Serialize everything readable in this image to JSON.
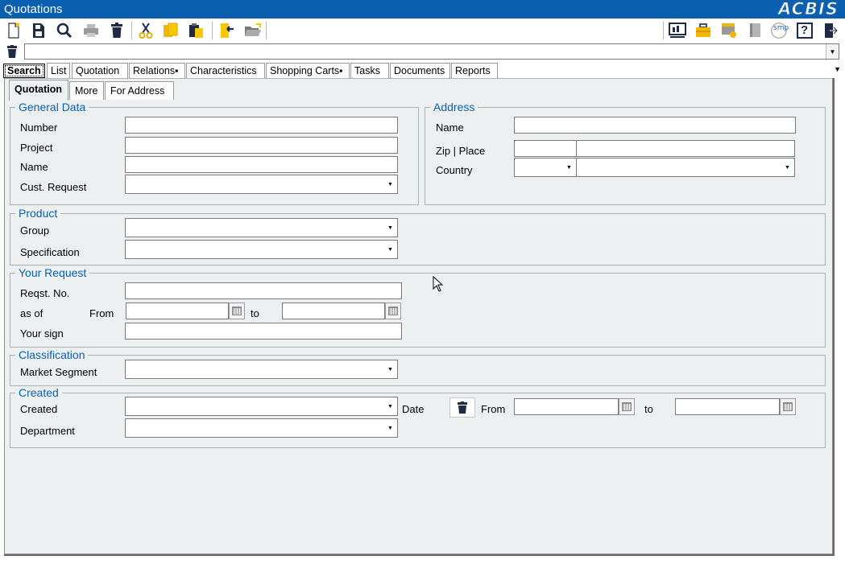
{
  "window": {
    "title": "Quotations",
    "logo": "ACBIS"
  },
  "toolbar": {
    "left_icons": [
      "new-document-icon",
      "save-icon",
      "search-icon",
      "print-icon",
      "delete-icon",
      "cut-icon",
      "copy-icon",
      "paste-icon",
      "import-icon",
      "open-folder-icon"
    ],
    "right_icons": [
      "monitor-icon",
      "briefcase-icon",
      "window-icon",
      "book-icon",
      "smp-icon",
      "help-icon",
      "exit-icon"
    ],
    "smp_label": "smp",
    "help_label": "?"
  },
  "filter": {
    "value": ""
  },
  "main_tabs": [
    {
      "label": "Search",
      "active": true
    },
    {
      "label": "List"
    },
    {
      "label": "Quotation"
    },
    {
      "label": "Relations▪"
    },
    {
      "label": "Characteristics"
    },
    {
      "label": "Shopping Carts▪"
    },
    {
      "label": "Tasks"
    },
    {
      "label": "Documents"
    },
    {
      "label": "Reports"
    }
  ],
  "sub_tabs": [
    {
      "label": "Quotation",
      "active": true
    },
    {
      "label": "More"
    },
    {
      "label": "For Address"
    }
  ],
  "general_data": {
    "legend": "General Data",
    "number_label": "Number",
    "project_label": "Project",
    "name_label": "Name",
    "cust_request_label": "Cust. Request"
  },
  "address": {
    "legend": "Address",
    "name_label": "Name",
    "zip_place_label": "Zip | Place",
    "country_label": "Country"
  },
  "product": {
    "legend": "Product",
    "group_label": "Group",
    "specification_label": "Specification"
  },
  "your_request": {
    "legend": "Your Request",
    "reqst_no_label": "Reqst. No.",
    "as_of_label": "as of",
    "from_label": "From",
    "to_label": "to",
    "your_sign_label": "Your sign"
  },
  "classification": {
    "legend": "Classification",
    "market_segment_label": "Market Segment"
  },
  "created": {
    "legend": "Created",
    "created_label": "Created",
    "date_label": "Date",
    "from_label": "From",
    "to_label": "to",
    "department_label": "Department"
  }
}
